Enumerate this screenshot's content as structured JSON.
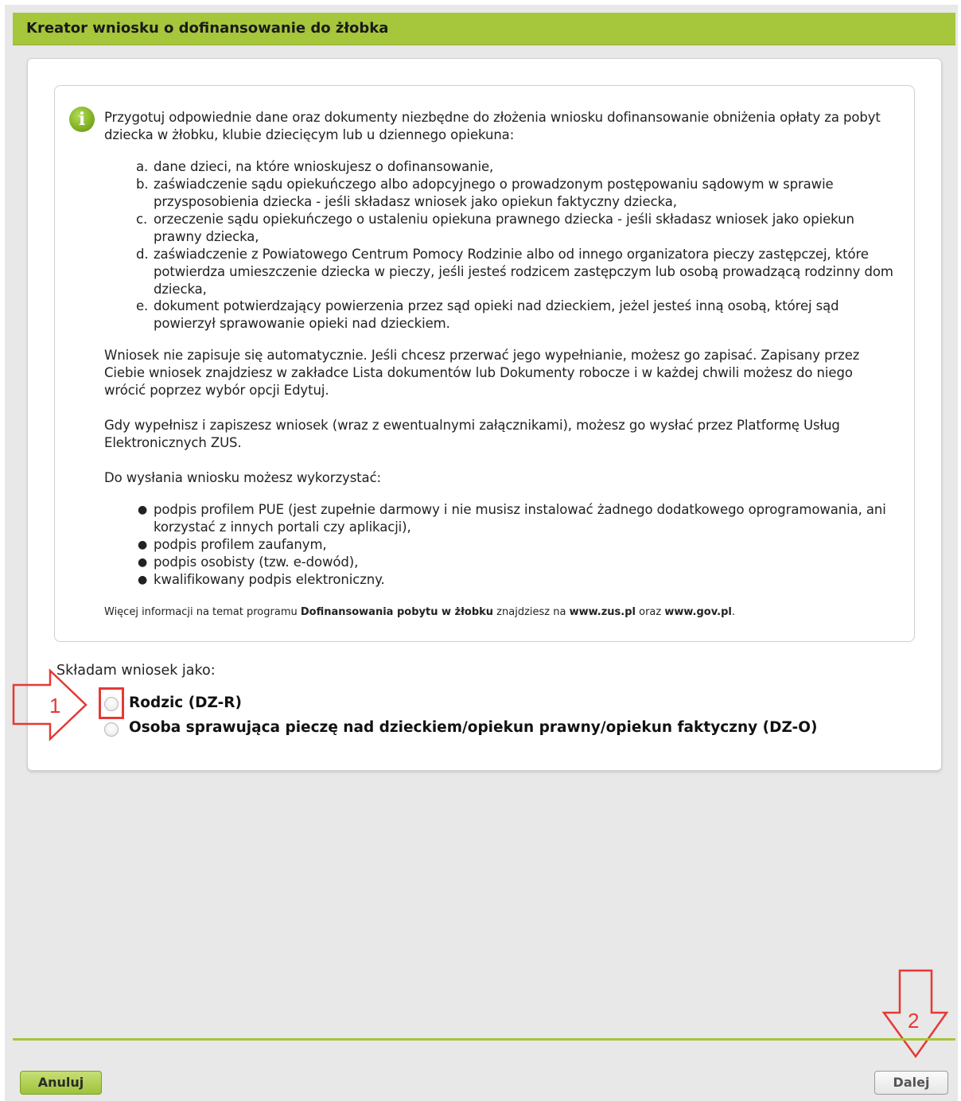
{
  "header": {
    "title": "Kreator wniosku o dofinansowanie do żłobka"
  },
  "info": {
    "intro_line1": "Przygotuj odpowiednie dane oraz dokumenty niezbędne do złożenia wniosku dofinansowanie obniżenia opłaty za pobyt",
    "intro_line2": "dziecka w żłobku, klubie dziecięcym lub u dziennego opiekuna:",
    "docs": [
      {
        "marker": "a.",
        "text": "dane dzieci, na które wnioskujesz o dofinansowanie,"
      },
      {
        "marker": "b.",
        "text": "zaświadczenie sądu opiekuńczego albo adopcyjnego o prowadzonym postępowaniu sądowym w sprawie przysposobienia dziecka - jeśli składasz wniosek jako opiekun faktyczny dziecka,"
      },
      {
        "marker": "c.",
        "text": "orzeczenie sądu opiekuńczego o ustaleniu opiekuna prawnego dziecka - jeśli składasz wniosek jako opiekun prawny dziecka,"
      },
      {
        "marker": "d.",
        "text": "zaświadczenie z Powiatowego Centrum Pomocy Rodzinie albo od innego organizatora pieczy zastępczej, które potwierdza umieszczenie dziecka w pieczy, jeśli jesteś rodzicem zastępczym lub osobą prowadzącą rodzinny dom dziecka,"
      },
      {
        "marker": "e.",
        "text": "dokument potwierdzający powierzenia przez sąd opieki nad dzieckiem, jeżel jesteś inną osobą, której sąd powierzył sprawowanie opieki nad dzieckiem."
      }
    ],
    "save_note_line1": "Wniosek nie zapisuje się automatycznie. Jeśli chcesz przerwać jego wypełnianie, możesz go zapisać. Zapisany przez",
    "save_note_line2": "Ciebie wniosek znajdziesz w zakładce Lista dokumentów lub Dokumenty robocze i w każdej chwili możesz do niego",
    "save_note_line3": "wrócić poprzez wybór opcji Edytuj.",
    "send_note_line1": "Gdy wypełnisz i zapiszesz wniosek (wraz z ewentualnymi załącznikami), możesz go wysłać przez Platformę Usług",
    "send_note_line2": "Elektronicznych ZUS.",
    "sign_intro": "Do wysłania wniosku możesz wykorzystać:",
    "sign_options": [
      "podpis profilem PUE (jest zupełnie darmowy i nie musisz instalować żadnego dodatkowego oprogramowania, ani korzystać z innych portali czy aplikacji),",
      "podpis profilem zaufanym,",
      "podpis osobisty (tzw. e-dowód),",
      "kwalifikowany podpis elektroniczny."
    ],
    "more_info": {
      "prefix": "Więcej informacji na temat programu ",
      "program": "Dofinansowania pobytu w żłobku",
      "middle": " znajdziesz na ",
      "link1": "www.zus.pl",
      "and": " oraz ",
      "link2": "www.gov.pl",
      "suffix": "."
    }
  },
  "form": {
    "question": "Składam wniosek jako:",
    "options": [
      {
        "label": "Rodzic (DZ-R)",
        "selected": false
      },
      {
        "label": "Osoba sprawująca pieczę nad dzieckiem/opiekun prawny/opiekun faktyczny (DZ-O)",
        "selected": false
      }
    ]
  },
  "annotations": {
    "step1": "1",
    "step2": "2",
    "color": "#e53935"
  },
  "buttons": {
    "cancel": "Anuluj",
    "next": "Dalej"
  },
  "colors": {
    "accent": "#a6c63b",
    "background": "#e8e8e8"
  }
}
